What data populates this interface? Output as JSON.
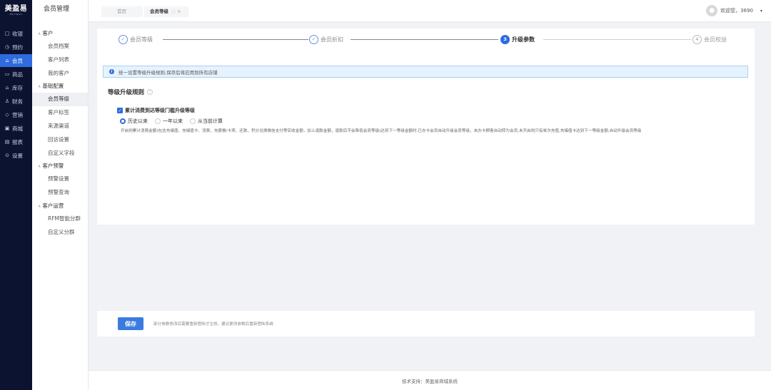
{
  "rail": {
    "logo_main": "美盈易",
    "logo_sub": "MEIYINGYI",
    "items": [
      {
        "icon": "□",
        "label": "收银"
      },
      {
        "icon": "◷",
        "label": "预约"
      },
      {
        "icon": "⌂",
        "label": "会员"
      },
      {
        "icon": "▭",
        "label": "商品"
      },
      {
        "icon": "⌂",
        "label": "库存"
      },
      {
        "icon": "♙",
        "label": "财务"
      },
      {
        "icon": "◇",
        "label": "营销"
      },
      {
        "icon": "▣",
        "label": "商城"
      },
      {
        "icon": "▤",
        "label": "报表"
      },
      {
        "icon": "⊙",
        "label": "设置"
      }
    ],
    "active_index": 2
  },
  "sub": {
    "title": "会员管理",
    "groups": [
      {
        "label": "客户",
        "items": [
          "会员档案",
          "客户列表",
          "我的客户"
        ]
      },
      {
        "label": "基础配置",
        "items": [
          "会员等级",
          "客户标签",
          "来源渠道",
          "回访设置",
          "自定义字段"
        ]
      },
      {
        "label": "客户预警",
        "items": [
          "预警设置",
          "预警查询"
        ]
      },
      {
        "label": "客户运营",
        "items": [
          "RFM智能分群",
          "自定义分群"
        ]
      }
    ]
  },
  "topbar": {
    "tab_home": "首页",
    "tab_current": "会员等级",
    "tab_current_icons": "◌ ×",
    "welcome": "欢迎您，3690",
    "caret": "▾"
  },
  "steps": [
    {
      "num": "✓",
      "label": "会员等级"
    },
    {
      "num": "✓",
      "label": "会员折扣"
    },
    {
      "num": "3",
      "label": "升级参数"
    },
    {
      "num": "4",
      "label": "会员权益"
    }
  ],
  "notice": {
    "icon": "i",
    "text": "统一设置等级升级规则,保存后将应用到所有店铺"
  },
  "rules": {
    "title": "等级升级规则",
    "help_icon": "?",
    "checkbox_label": "累计消费到达等级门槛升级等级",
    "checkbox_checked": true,
    "radios": [
      "历史以来",
      "一年以来",
      "从当前计算"
    ],
    "radio_selected": 0,
    "description": "开启则累计消费金额(包含充储值、充储值卡、消费、充套餐/卡项、还款、积分兑换微信支付等实收金额，加上退款金额，退款后不会降低会员等级)达到下一等级金额时,已办卡会员自动升级会员等级，未办卡顾客自动转为会员,未开启则只有单次充值,充储值卡达到下一等级金额,自动升级会员等级"
  },
  "savebar": {
    "save_label": "保存",
    "hint": "部分参数修改后需要重新登陆才生效，建议更改参数后重新登陆系统"
  },
  "footer": {
    "text": "技术支持：美盈易商城系统"
  },
  "colors": {
    "rail_bg": "#0c1330",
    "accent": "#2f6bdf",
    "notice_bg": "#e6f2fd"
  }
}
